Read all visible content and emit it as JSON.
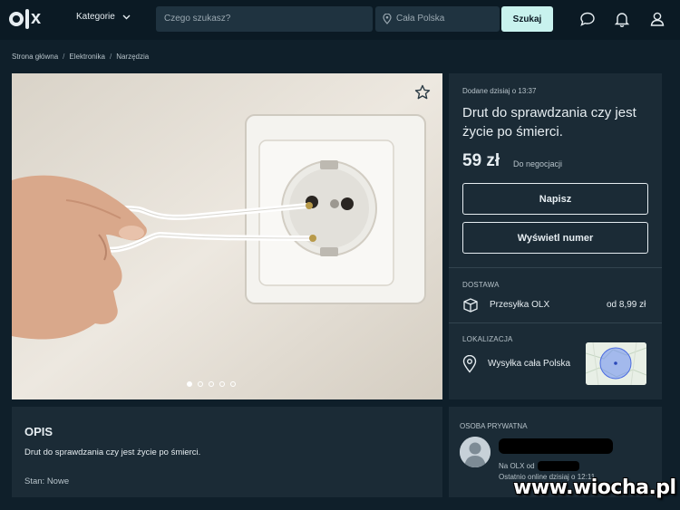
{
  "header": {
    "logo_text": "olx",
    "categories_label": "Kategorie",
    "search_placeholder": "Czego szukasz?",
    "location_placeholder": "Cała Polska",
    "search_button": "Szukaj",
    "icons": [
      "chat-icon",
      "bell-icon",
      "user-icon"
    ]
  },
  "breadcrumb": [
    "Strona główna",
    "Elektronika",
    "Narzędzia"
  ],
  "gallery": {
    "image_count": 5,
    "active_index": 0
  },
  "listing": {
    "added": "Dodane dzisiaj o 13:37",
    "title": "Drut do sprawdzania czy jest życie po śmierci.",
    "price": "59 zł",
    "negotiable": "Do negocjacji",
    "write_button": "Napisz",
    "show_number_button": "Wyświetl numer"
  },
  "delivery": {
    "label": "DOSTAWA",
    "method": "Przesyłka OLX",
    "price": "od 8,99 zł"
  },
  "location": {
    "label": "LOKALIZACJA",
    "value": "Wysyłka cała Polska"
  },
  "description": {
    "heading": "OPIS",
    "text": "Drut do sprawdzania czy jest życie po śmierci.",
    "condition": "Stan: Nowe"
  },
  "seller": {
    "label": "OSOBA PRYWATNA",
    "since": "Na OLX od",
    "last_online": "Ostatnio online dzisiaj o 12:11"
  },
  "watermark": "www.wiocha.pl",
  "colors": {
    "background": "#0f1f2a",
    "panel": "#1b2b36",
    "accent_button": "#c8f2ee",
    "text": "#e6edf1"
  }
}
